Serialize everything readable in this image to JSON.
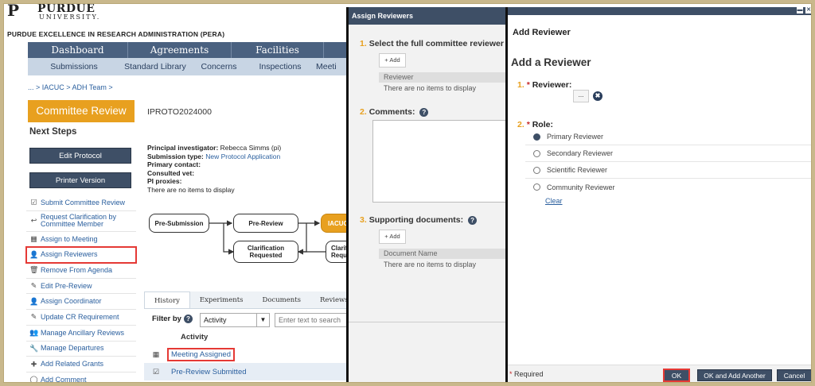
{
  "brand": {
    "logo_mark": "P",
    "name": "PURDUE",
    "sub": "UNIVERSITY.",
    "system": "PURDUE EXCELLENCE IN RESEARCH ADMINISTRATION (PERA)"
  },
  "nav_primary": [
    "Dashboard",
    "Agreements",
    "Facilities"
  ],
  "nav_secondary": [
    "Submissions",
    "Standard Library",
    "Concerns",
    "Inspections",
    "Meeti"
  ],
  "breadcrumb": "... > IACUC > ADH Team >",
  "state_button": "Committee Review",
  "protocol_id": "IPROTO2024000",
  "next_steps_title": "Next Steps",
  "buttons": {
    "edit_protocol": "Edit Protocol",
    "printer_version": "Printer Version"
  },
  "actions": [
    {
      "icon": "checkbox-icon",
      "glyph": "☑",
      "label": "Submit Committee Review"
    },
    {
      "icon": "reply-icon",
      "glyph": "↩",
      "label": "Request Clarification by Committee Member"
    },
    {
      "icon": "calendar-icon",
      "glyph": "▦",
      "label": "Assign to Meeting"
    },
    {
      "icon": "user-add-icon",
      "glyph": "👤",
      "label": "Assign Reviewers"
    },
    {
      "icon": "trash-icon",
      "glyph": "🗑",
      "label": "Remove From Agenda"
    },
    {
      "icon": "pencil-icon",
      "glyph": "✎",
      "label": "Edit Pre-Review"
    },
    {
      "icon": "user-add-icon",
      "glyph": "👤",
      "label": "Assign Coordinator"
    },
    {
      "icon": "pencil-icon",
      "glyph": "✎",
      "label": "Update CR Requirement"
    },
    {
      "icon": "users-icon",
      "glyph": "👥",
      "label": "Manage Ancillary Reviews"
    },
    {
      "icon": "wrench-icon",
      "glyph": "🔧",
      "label": "Manage Departures"
    },
    {
      "icon": "plus-icon",
      "glyph": "✚",
      "label": "Add Related Grants"
    },
    {
      "icon": "comment-icon",
      "glyph": "◯",
      "label": "Add Comment"
    }
  ],
  "info": {
    "pi_label": "Principal investigator:",
    "pi_value": "Rebecca  Simms (pi)",
    "type_label": "Submission type:",
    "type_value": "New Protocol Application",
    "contact_label": "Primary contact:",
    "vet_label": "Consulted vet:",
    "proxies_label": "PI proxies:",
    "proxies_value": "There are no items to display"
  },
  "workflow": {
    "pre_submission": "Pre-Submission",
    "pre_review": "Pre-Review",
    "iacuc": "IACUC",
    "clarification_requested": "Clarification Requested",
    "clarif_partial": "Clarifi Reque"
  },
  "tabs": [
    "History",
    "Experiments",
    "Documents",
    "Reviews"
  ],
  "filter": {
    "label": "Filter by",
    "selected": "Activity",
    "placeholder": "Enter text to search"
  },
  "history": {
    "column": "Activity",
    "rows": [
      {
        "icon": "calendar-icon",
        "glyph": "▦",
        "label": "Meeting Assigned"
      },
      {
        "icon": "checkbox-icon",
        "glyph": "☑",
        "label": "Pre-Review Submitted"
      }
    ]
  },
  "assign_panel": {
    "title": "Assign Reviewers",
    "step1_num": "1.",
    "step1": "Select the full committee reviewer",
    "add_label": "+ Add",
    "reviewer_col": "Reviewer",
    "no_items": "There are no items to display",
    "step2_num": "2.",
    "step2": "Comments:",
    "step3_num": "3.",
    "step3": "Supporting documents:",
    "doc_col": "Document Name",
    "no_items_docs": "There are no items to display"
  },
  "add_dialog": {
    "title": "Add Reviewer",
    "heading": "Add a Reviewer",
    "step1_num": "1.",
    "step1": "Reviewer:",
    "step2_num": "2.",
    "step2": "Role:",
    "required_star": "*",
    "ellipsis": "...",
    "clear_x": "✖",
    "roles": [
      {
        "label": "Primary Reviewer",
        "selected": true
      },
      {
        "label": "Secondary Reviewer",
        "selected": false
      },
      {
        "label": "Scientific Reviewer",
        "selected": false
      },
      {
        "label": "Community Reviewer",
        "selected": false
      }
    ],
    "clear": "Clear",
    "required_note": "Required",
    "ok": "OK",
    "ok_add_another": "OK and Add Another",
    "cancel": "Cancel",
    "minimize": "▬",
    "close": "✕"
  },
  "colors": {
    "accent_orange": "#e8a01f",
    "nav_dark": "#3e4f66",
    "link": "#2a5f9e",
    "highlight": "#e53935"
  }
}
